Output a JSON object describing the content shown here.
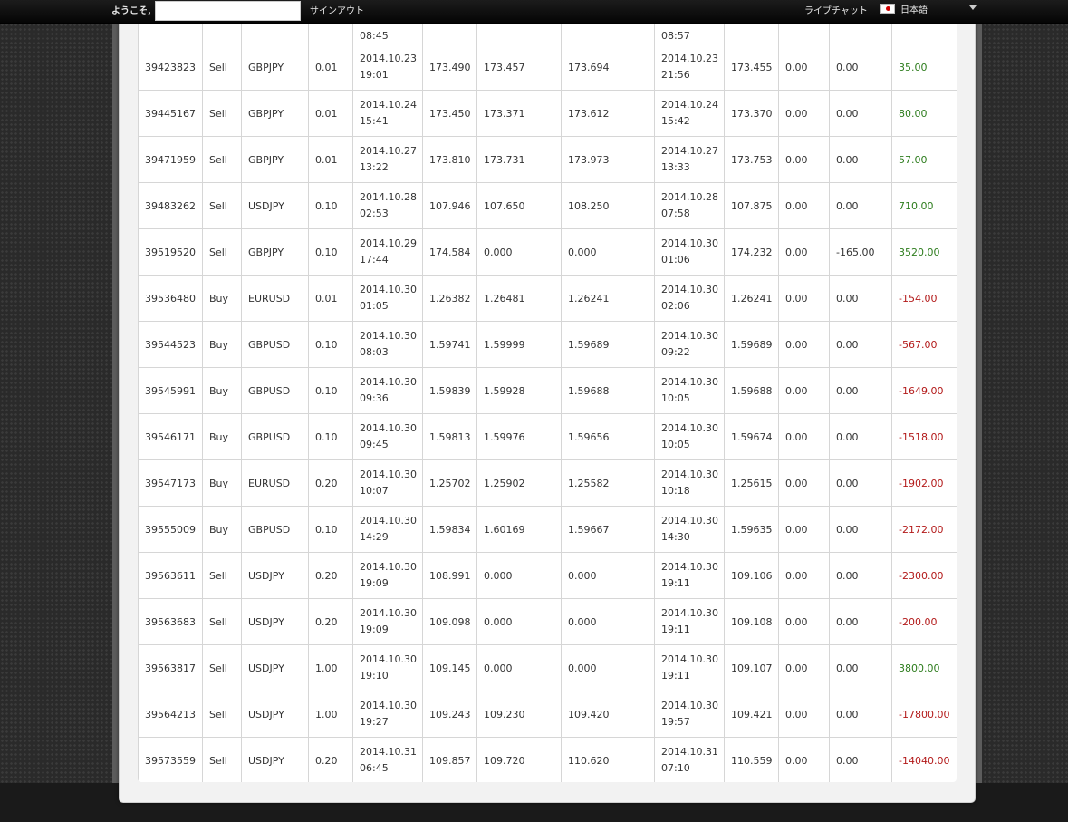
{
  "header": {
    "welcome": "ようこそ,",
    "signout": "サインアウト",
    "livechat": "ライブチャット",
    "language": "日本語",
    "flag_icon": "japan-flag-icon"
  },
  "colors": {
    "profit": "#2e7d1e",
    "loss": "#b31a1a"
  },
  "partial_row": {
    "open_time": "08:45",
    "close_time": "08:57"
  },
  "rows": [
    {
      "ticket": "39423823",
      "type": "Sell",
      "symbol": "GBPJPY",
      "lots": "0.01",
      "open_date": "2014.10.23",
      "open_time": "19:01",
      "open_price": "173.490",
      "sl": "173.457",
      "tp": "173.694",
      "close_date": "2014.10.23",
      "close_time": "21:56",
      "close_price": "173.455",
      "commission": "0.00",
      "swap": "0.00",
      "profit": "35.00",
      "sign": "pos"
    },
    {
      "ticket": "39445167",
      "type": "Sell",
      "symbol": "GBPJPY",
      "lots": "0.01",
      "open_date": "2014.10.24",
      "open_time": "15:41",
      "open_price": "173.450",
      "sl": "173.371",
      "tp": "173.612",
      "close_date": "2014.10.24",
      "close_time": "15:42",
      "close_price": "173.370",
      "commission": "0.00",
      "swap": "0.00",
      "profit": "80.00",
      "sign": "pos"
    },
    {
      "ticket": "39471959",
      "type": "Sell",
      "symbol": "GBPJPY",
      "lots": "0.01",
      "open_date": "2014.10.27",
      "open_time": "13:22",
      "open_price": "173.810",
      "sl": "173.731",
      "tp": "173.973",
      "close_date": "2014.10.27",
      "close_time": "13:33",
      "close_price": "173.753",
      "commission": "0.00",
      "swap": "0.00",
      "profit": "57.00",
      "sign": "pos"
    },
    {
      "ticket": "39483262",
      "type": "Sell",
      "symbol": "USDJPY",
      "lots": "0.10",
      "open_date": "2014.10.28",
      "open_time": "02:53",
      "open_price": "107.946",
      "sl": "107.650",
      "tp": "108.250",
      "close_date": "2014.10.28",
      "close_time": "07:58",
      "close_price": "107.875",
      "commission": "0.00",
      "swap": "0.00",
      "profit": "710.00",
      "sign": "pos"
    },
    {
      "ticket": "39519520",
      "type": "Sell",
      "symbol": "GBPJPY",
      "lots": "0.10",
      "open_date": "2014.10.29",
      "open_time": "17:44",
      "open_price": "174.584",
      "sl": "0.000",
      "tp": "0.000",
      "close_date": "2014.10.30",
      "close_time": "01:06",
      "close_price": "174.232",
      "commission": "0.00",
      "swap": "-165.00",
      "profit": "3520.00",
      "sign": "pos"
    },
    {
      "ticket": "39536480",
      "type": "Buy",
      "symbol": "EURUSD",
      "lots": "0.01",
      "open_date": "2014.10.30",
      "open_time": "01:05",
      "open_price": "1.26382",
      "sl": "1.26481",
      "tp": "1.26241",
      "close_date": "2014.10.30",
      "close_time": "02:06",
      "close_price": "1.26241",
      "commission": "0.00",
      "swap": "0.00",
      "profit": "-154.00",
      "sign": "neg"
    },
    {
      "ticket": "39544523",
      "type": "Buy",
      "symbol": "GBPUSD",
      "lots": "0.10",
      "open_date": "2014.10.30",
      "open_time": "08:03",
      "open_price": "1.59741",
      "sl": "1.59999",
      "tp": "1.59689",
      "close_date": "2014.10.30",
      "close_time": "09:22",
      "close_price": "1.59689",
      "commission": "0.00",
      "swap": "0.00",
      "profit": "-567.00",
      "sign": "neg"
    },
    {
      "ticket": "39545991",
      "type": "Buy",
      "symbol": "GBPUSD",
      "lots": "0.10",
      "open_date": "2014.10.30",
      "open_time": "09:36",
      "open_price": "1.59839",
      "sl": "1.59928",
      "tp": "1.59688",
      "close_date": "2014.10.30",
      "close_time": "10:05",
      "close_price": "1.59688",
      "commission": "0.00",
      "swap": "0.00",
      "profit": "-1649.00",
      "sign": "neg"
    },
    {
      "ticket": "39546171",
      "type": "Buy",
      "symbol": "GBPUSD",
      "lots": "0.10",
      "open_date": "2014.10.30",
      "open_time": "09:45",
      "open_price": "1.59813",
      "sl": "1.59976",
      "tp": "1.59656",
      "close_date": "2014.10.30",
      "close_time": "10:05",
      "close_price": "1.59674",
      "commission": "0.00",
      "swap": "0.00",
      "profit": "-1518.00",
      "sign": "neg"
    },
    {
      "ticket": "39547173",
      "type": "Buy",
      "symbol": "EURUSD",
      "lots": "0.20",
      "open_date": "2014.10.30",
      "open_time": "10:07",
      "open_price": "1.25702",
      "sl": "1.25902",
      "tp": "1.25582",
      "close_date": "2014.10.30",
      "close_time": "10:18",
      "close_price": "1.25615",
      "commission": "0.00",
      "swap": "0.00",
      "profit": "-1902.00",
      "sign": "neg"
    },
    {
      "ticket": "39555009",
      "type": "Buy",
      "symbol": "GBPUSD",
      "lots": "0.10",
      "open_date": "2014.10.30",
      "open_time": "14:29",
      "open_price": "1.59834",
      "sl": "1.60169",
      "tp": "1.59667",
      "close_date": "2014.10.30",
      "close_time": "14:30",
      "close_price": "1.59635",
      "commission": "0.00",
      "swap": "0.00",
      "profit": "-2172.00",
      "sign": "neg"
    },
    {
      "ticket": "39563611",
      "type": "Sell",
      "symbol": "USDJPY",
      "lots": "0.20",
      "open_date": "2014.10.30",
      "open_time": "19:09",
      "open_price": "108.991",
      "sl": "0.000",
      "tp": "0.000",
      "close_date": "2014.10.30",
      "close_time": "19:11",
      "close_price": "109.106",
      "commission": "0.00",
      "swap": "0.00",
      "profit": "-2300.00",
      "sign": "neg"
    },
    {
      "ticket": "39563683",
      "type": "Sell",
      "symbol": "USDJPY",
      "lots": "0.20",
      "open_date": "2014.10.30",
      "open_time": "19:09",
      "open_price": "109.098",
      "sl": "0.000",
      "tp": "0.000",
      "close_date": "2014.10.30",
      "close_time": "19:11",
      "close_price": "109.108",
      "commission": "0.00",
      "swap": "0.00",
      "profit": "-200.00",
      "sign": "neg"
    },
    {
      "ticket": "39563817",
      "type": "Sell",
      "symbol": "USDJPY",
      "lots": "1.00",
      "open_date": "2014.10.30",
      "open_time": "19:10",
      "open_price": "109.145",
      "sl": "0.000",
      "tp": "0.000",
      "close_date": "2014.10.30",
      "close_time": "19:11",
      "close_price": "109.107",
      "commission": "0.00",
      "swap": "0.00",
      "profit": "3800.00",
      "sign": "pos"
    },
    {
      "ticket": "39564213",
      "type": "Sell",
      "symbol": "USDJPY",
      "lots": "1.00",
      "open_date": "2014.10.30",
      "open_time": "19:27",
      "open_price": "109.243",
      "sl": "109.230",
      "tp": "109.420",
      "close_date": "2014.10.30",
      "close_time": "19:57",
      "close_price": "109.421",
      "commission": "0.00",
      "swap": "0.00",
      "profit": "-17800.00",
      "sign": "neg"
    },
    {
      "ticket": "39573559",
      "type": "Sell",
      "symbol": "USDJPY",
      "lots": "0.20",
      "open_date": "2014.10.31",
      "open_time": "06:45",
      "open_price": "109.857",
      "sl": "109.720",
      "tp": "110.620",
      "close_date": "2014.10.31",
      "close_time": "07:10",
      "close_price": "110.559",
      "commission": "0.00",
      "swap": "0.00",
      "profit": "-14040.00",
      "sign": "neg"
    }
  ]
}
